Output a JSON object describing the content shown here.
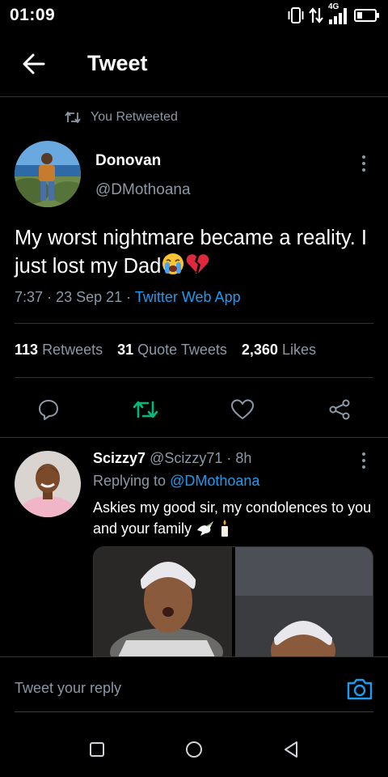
{
  "status_bar": {
    "time": "01:09",
    "network": "4G",
    "icons": [
      "vibrate-icon",
      "data-arrows-icon",
      "signal-icon",
      "battery-icon"
    ]
  },
  "header": {
    "title": "Tweet",
    "back_icon": "arrow-left-icon"
  },
  "retweet_context": {
    "label": "You Retweeted",
    "icon": "retweet-icon"
  },
  "tweet": {
    "author_name": "Donovan",
    "author_handle": "@DMothoana",
    "text": "My worst nightmare became a reality. I just lost my Dad",
    "emojis": [
      "loudly-crying-face-emoji",
      "broken-heart-emoji"
    ],
    "time": "7:37",
    "date": "23 Sep 21",
    "separator": "·",
    "source": "Twitter Web App",
    "stats": {
      "retweets_count": "113",
      "retweets_label": "Retweets",
      "quotes_count": "31",
      "quotes_label": "Quote Tweets",
      "likes_count": "2,360",
      "likes_label": "Likes"
    },
    "actions": [
      "reply-icon",
      "retweet-icon",
      "like-icon",
      "share-icon"
    ],
    "retweeted": true
  },
  "reply": {
    "author_name": "Scizzy7",
    "author_handle": "@Scizzy71",
    "age": "8h",
    "replying_prefix": "Replying to",
    "replying_to": "@DMothoana",
    "text": "Askies my good sir, my condolences to you and your family",
    "emojis": [
      "dove-emoji",
      "candle-emoji"
    ],
    "media_count": 2
  },
  "composer": {
    "placeholder": "Tweet your reply",
    "camera_icon": "camera-icon"
  },
  "system_nav": {
    "buttons": [
      "recents-square-icon",
      "home-circle-icon",
      "back-triangle-icon"
    ]
  },
  "colors": {
    "background": "#000000",
    "text": "#e7e9ea",
    "secondary_text": "#8b98a5",
    "accent_blue": "#1d9bf0",
    "retweet_green": "#00ba7c",
    "divider": "#2f3336"
  }
}
